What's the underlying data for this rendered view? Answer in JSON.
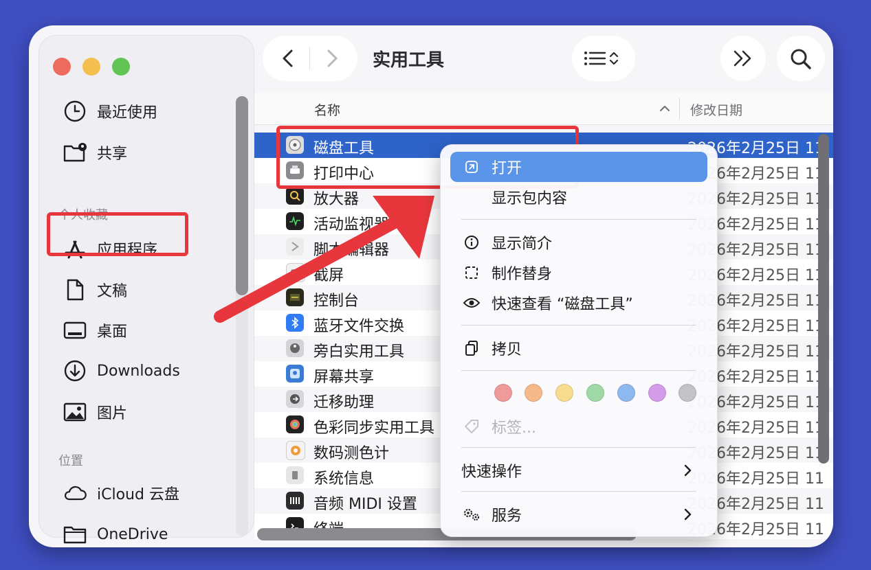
{
  "window": {
    "title": "实用工具"
  },
  "sidebar": {
    "items": [
      {
        "label": "最近使用",
        "icon": "clock-icon"
      },
      {
        "label": "共享",
        "icon": "shared-folder-icon"
      },
      {
        "label": "应用程序",
        "icon": "applications-icon"
      },
      {
        "label": "文稿",
        "icon": "document-icon"
      },
      {
        "label": "桌面",
        "icon": "desktop-icon"
      },
      {
        "label": "Downloads",
        "icon": "download-icon"
      },
      {
        "label": "图片",
        "icon": "photo-icon"
      },
      {
        "label": "iCloud 云盘",
        "icon": "cloud-icon"
      },
      {
        "label": "OneDrive",
        "icon": "folder-icon"
      }
    ],
    "sections": {
      "favorites": "个人收藏",
      "locations": "位置"
    }
  },
  "list": {
    "col_name": "名称",
    "col_date": "修改日期",
    "rows": [
      {
        "name": "磁盘工具",
        "date": "2026年2月25日 11",
        "icon": "disk-utility-icon",
        "selected": true
      },
      {
        "name": "打印中心",
        "date": "2026年2月25日 11",
        "icon": "printer-icon"
      },
      {
        "name": "放大器",
        "date": "2026年2月25日 11",
        "icon": "magnifier-icon"
      },
      {
        "name": "活动监视器",
        "date": "2026年2月25日 11",
        "icon": "activity-monitor-icon"
      },
      {
        "name": "脚本编辑器",
        "date": "2026年2月25日 11",
        "icon": "script-editor-icon"
      },
      {
        "name": "截屏",
        "date": "2026年2月25日 11",
        "icon": "screenshot-icon"
      },
      {
        "name": "控制台",
        "date": "2026年2月25日 11",
        "icon": "console-icon"
      },
      {
        "name": "蓝牙文件交换",
        "date": "2026年2月25日 11",
        "icon": "bluetooth-icon"
      },
      {
        "name": "旁白实用工具",
        "date": "2026年2月25日 11",
        "icon": "voiceover-icon"
      },
      {
        "name": "屏幕共享",
        "date": "2026年2月25日 11",
        "icon": "screen-sharing-icon"
      },
      {
        "name": "迁移助理",
        "date": "2026年2月25日 11",
        "icon": "migration-icon"
      },
      {
        "name": "色彩同步实用工具",
        "date": "2026年2月25日 11",
        "icon": "colorsync-icon"
      },
      {
        "name": "数码测色计",
        "date": "2026年2月25日 11",
        "icon": "color-meter-icon"
      },
      {
        "name": "系统信息",
        "date": "2026年2月25日 11",
        "icon": "system-info-icon"
      },
      {
        "name": "音频 MIDI 设置",
        "date": "2026年2月25日 11",
        "icon": "audio-midi-icon"
      },
      {
        "name": "终端",
        "date": "2026年2月25日 11",
        "icon": "terminal-icon"
      }
    ]
  },
  "menu": {
    "open": "打开",
    "show_package": "显示包内容",
    "get_info": "显示简介",
    "make_alias": "制作替身",
    "quick_look": "快速查看 “磁盘工具”",
    "copy": "拷贝",
    "tags": "标签...",
    "quick_actions": "快速操作",
    "services": "服务",
    "tag_colors": [
      "#ef9b9b",
      "#f6b98c",
      "#f7dc8f",
      "#9fd9a5",
      "#8eb9f0",
      "#d49be8",
      "#c4c4c8"
    ]
  },
  "colors": {
    "accent": "#2e63c9",
    "highlight": "#e8363d",
    "menu_active": "#5b95ea"
  }
}
